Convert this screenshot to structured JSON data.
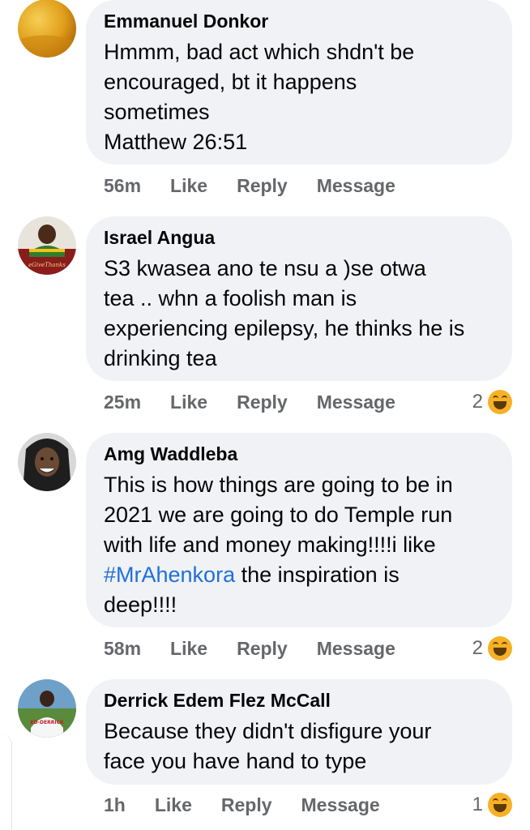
{
  "comments": [
    {
      "author": "Emmanuel Donkor",
      "text": "Hmmm, bad act which shdn't be\nencouraged, bt it happens\nsometimes\nMatthew 26:51",
      "time": "56m",
      "like": "Like",
      "reply": "Reply",
      "message": "Message",
      "reaction_count": "",
      "avatar_color": "#e8a81a"
    },
    {
      "author": "Israel Angua",
      "text": "S3 kwasea ano te nsu a )se otwa\ntea .. whn a foolish man is\nexperiencing epilepsy, he thinks he is\ndrinking tea",
      "time": "25m",
      "like": "Like",
      "reply": "Reply",
      "message": "Message",
      "reaction_count": "2",
      "reaction_icon": "haha-emoji-icon",
      "avatar_caption": "eGiveThanks",
      "avatar_color": "#8a1c1c"
    },
    {
      "author": "Amg Waddleba",
      "text_before": "This is how things are going to be in\n2021 we are going to do Temple run\nwith life and money making!!!!i like\n",
      "hashtag": "#MrAhenkora",
      "text_after": " the inspiration is\ndeep!!!!",
      "time": "58m",
      "like": "Like",
      "reply": "Reply",
      "message": "Message",
      "reaction_count": "2",
      "reaction_icon": "haha-emoji-icon",
      "avatar_color": "#2a2a2a"
    },
    {
      "author": "Derrick Edem Flez McCall",
      "text": "Because they didn't disfigure your\nface you have hand to type",
      "time": "1h",
      "like": "Like",
      "reply": "Reply",
      "message": "Message",
      "reaction_count": "1",
      "reaction_icon": "haha-emoji-icon",
      "avatar_caption": "ED-DERRICK",
      "avatar_color": "#6fa0c8"
    }
  ],
  "colors": {
    "bubble": "#f0f2f5",
    "action_text": "#65676b",
    "hashtag": "#216fdb"
  }
}
